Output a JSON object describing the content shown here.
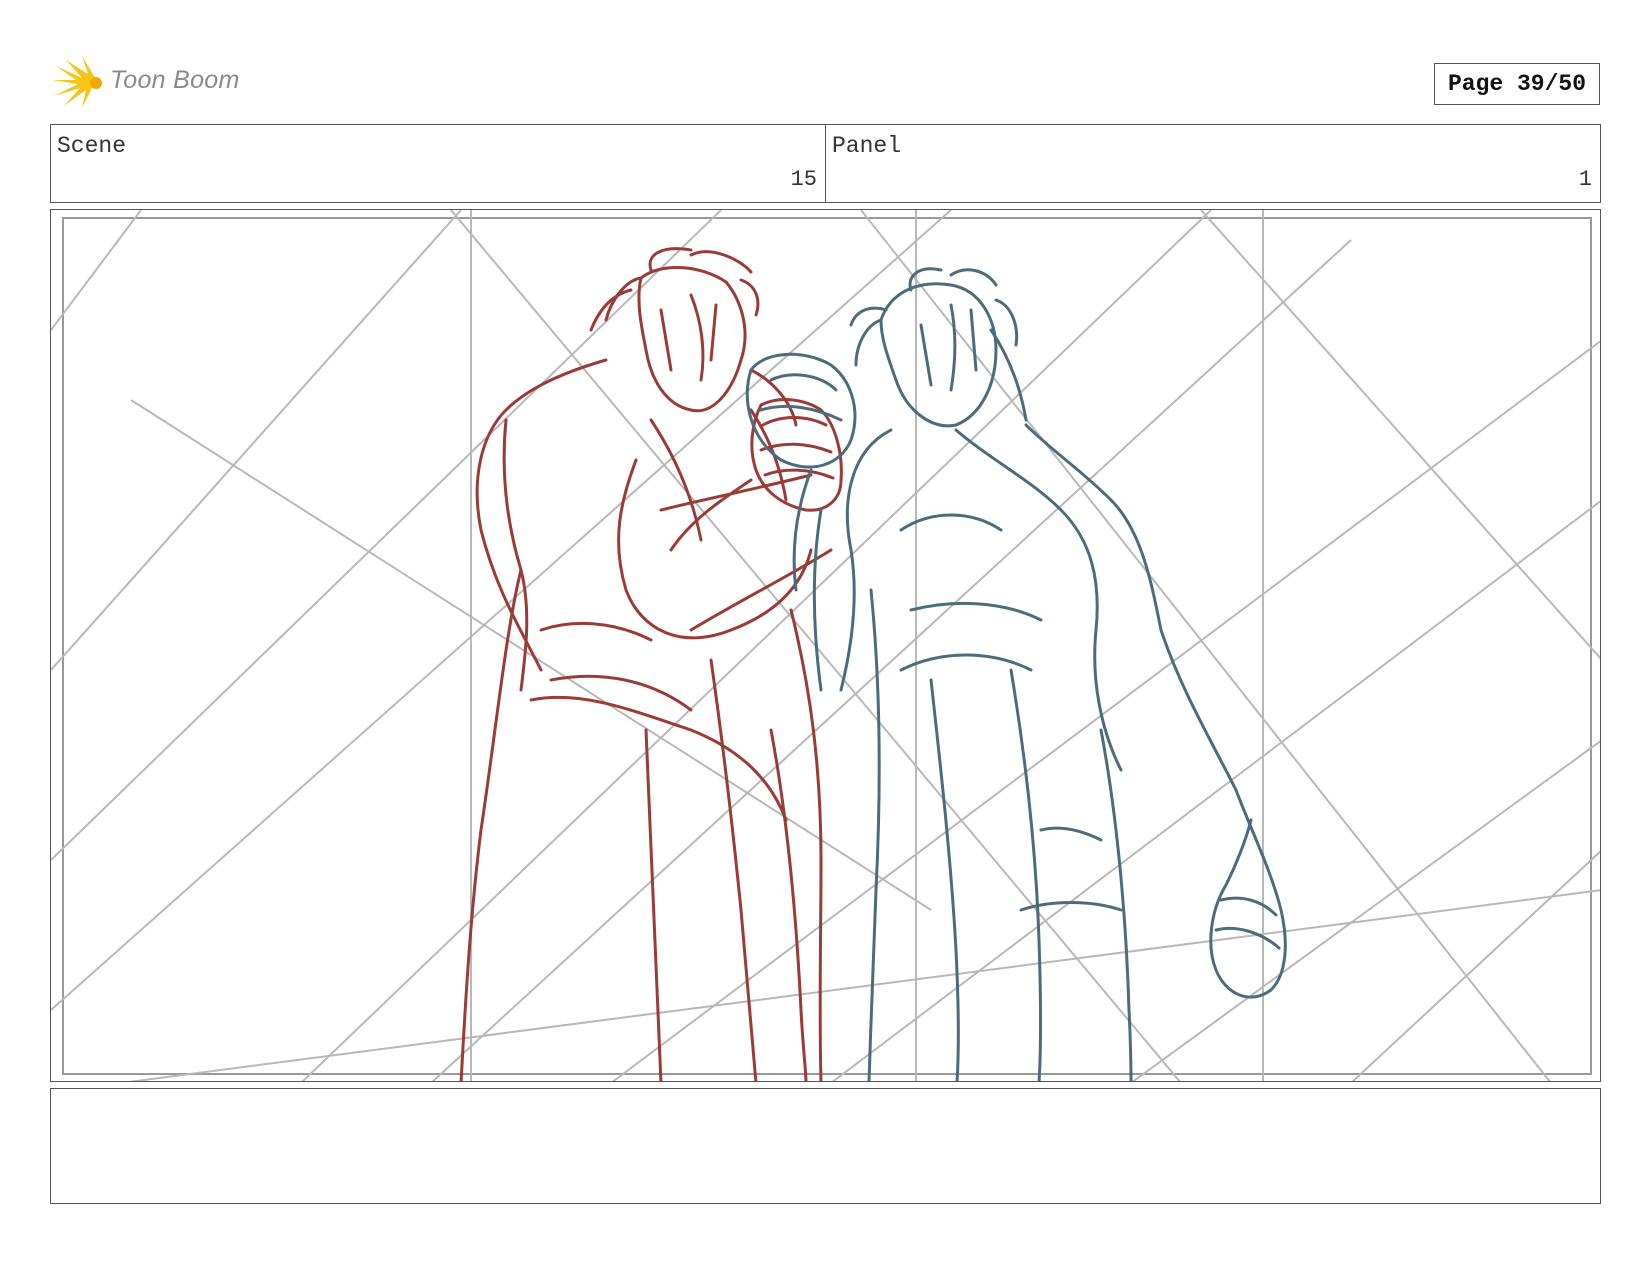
{
  "header": {
    "logo_text": "Toon Boom",
    "page_label": "Page 39/50"
  },
  "scene": {
    "label": "Scene",
    "value": "15"
  },
  "panel": {
    "label": "Panel",
    "value": "1"
  },
  "artwork": {
    "description_icon": "storyboard-sketch",
    "colors": {
      "guides": "#b8b8b8",
      "character_left": "#9b3b36",
      "character_right": "#4e6b7c",
      "logo_accent": "#f5c518"
    }
  },
  "notes": {
    "text": ""
  }
}
